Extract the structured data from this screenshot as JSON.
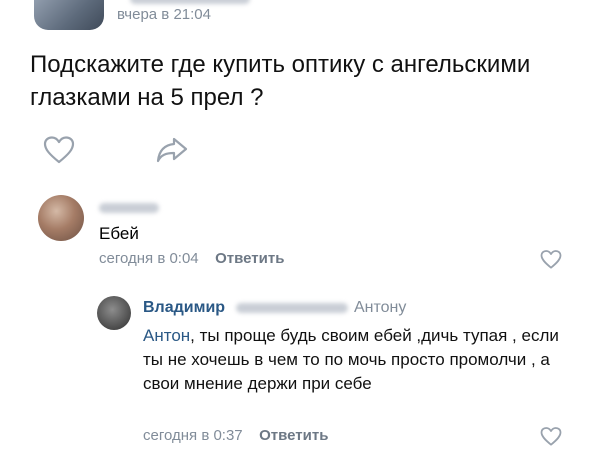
{
  "post": {
    "time": "вчера в 21:04",
    "text": "Подскажите где купить оптику с ангельскими глазками  на 5 прел  ?"
  },
  "comments": [
    {
      "text": "Ебей",
      "time": "сегодня в 0:04",
      "reply_label": "Ответить"
    },
    {
      "author": "Владимир",
      "reply_to": "Антону",
      "mention": "Антон",
      "text": ", ты проще будь  своим ебей ,дичь тупая , если ты не хочешь в чем то по мочь просто промолчи  , а свои мнение держи при себе",
      "time": "сегодня в 0:37",
      "reply_label": "Ответить"
    }
  ],
  "colors": {
    "muted": "#818c99",
    "link": "#2a5885",
    "icon": "#99a2ad"
  },
  "icons": {
    "like": "heart-icon",
    "share": "share-arrow-icon"
  }
}
